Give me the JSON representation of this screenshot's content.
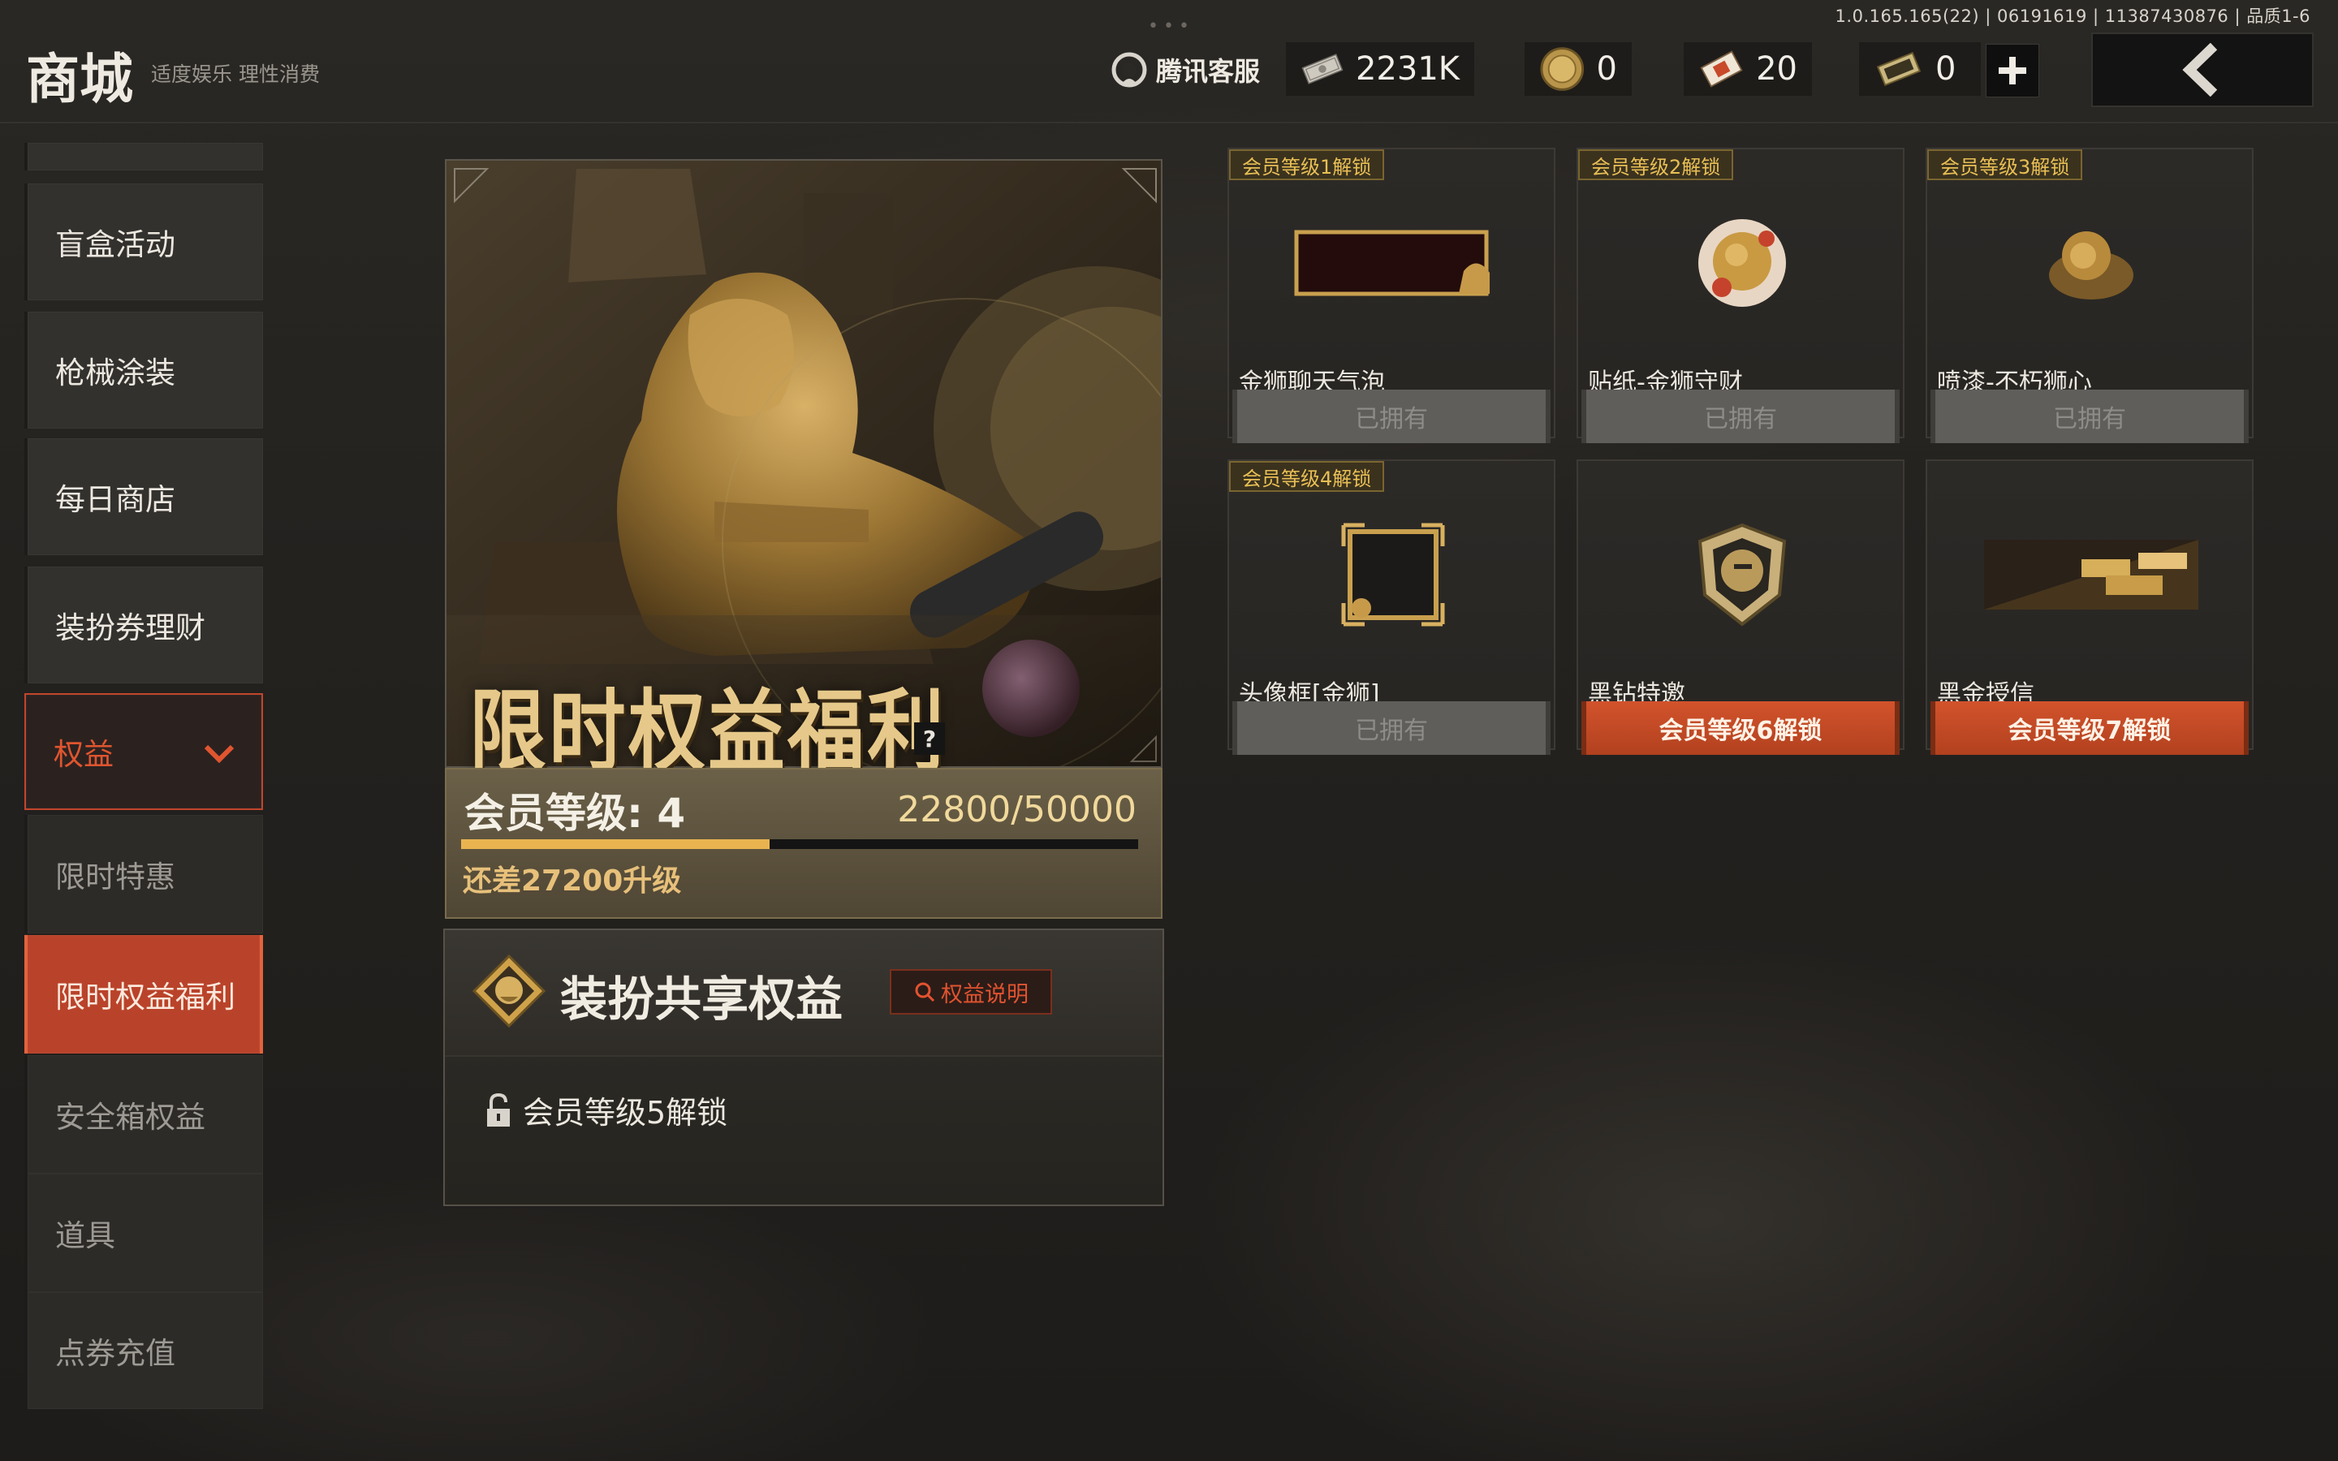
{
  "header": {
    "title": "商城",
    "subtitle": "适度娱乐 理性消费",
    "version": "1.0.165.165(22) | 06191619 | 11387430876 | 品质1-6",
    "customer_service": "腾讯客服",
    "currencies": [
      {
        "icon": "cash-icon",
        "value": "2231K"
      },
      {
        "icon": "coin-icon",
        "value": "0"
      },
      {
        "icon": "ticket-icon",
        "value": "20"
      },
      {
        "icon": "voucher-icon",
        "value": "0"
      }
    ]
  },
  "sidebar": {
    "items": [
      {
        "label": "盲盒活动"
      },
      {
        "label": "枪械涂装"
      },
      {
        "label": "每日商店"
      },
      {
        "label": "装扮券理财"
      },
      {
        "label": "权益"
      },
      {
        "label": "限时特惠"
      },
      {
        "label": "限时权益福利"
      },
      {
        "label": "安全箱权益"
      },
      {
        "label": "道具"
      },
      {
        "label": "点券充值"
      }
    ]
  },
  "hero": {
    "title": "限时权益福利",
    "help": "?",
    "level_label": "会员等级: 4",
    "exp_text": "22800/50000",
    "exp_progress": 0.456,
    "remain_text": "还差27200升级"
  },
  "share": {
    "title": "装扮共享权益",
    "rights_button": "权益说明",
    "lock_text": "会员等级5解锁"
  },
  "rewards": [
    {
      "tag": "会员等级1解锁",
      "name": "金狮聊天气泡",
      "button": "已拥有",
      "state": "owned"
    },
    {
      "tag": "会员等级2解锁",
      "name": "贴纸-金狮守财",
      "button": "已拥有",
      "state": "owned"
    },
    {
      "tag": "会员等级3解锁",
      "name": "喷漆-不朽狮心",
      "button": "已拥有",
      "state": "owned"
    },
    {
      "tag": "会员等级4解锁",
      "name": "头像框[金狮]",
      "button": "已拥有",
      "state": "owned"
    },
    {
      "tag": "",
      "name": "黑钻特邀",
      "button": "会员等级6解锁",
      "state": "locked"
    },
    {
      "tag": "",
      "name": "黑金授信",
      "button": "会员等级7解锁",
      "state": "locked"
    }
  ],
  "colors": {
    "accent": "#c2452b",
    "gold": "#e9b450",
    "owned_button": "#5f5e5b"
  }
}
